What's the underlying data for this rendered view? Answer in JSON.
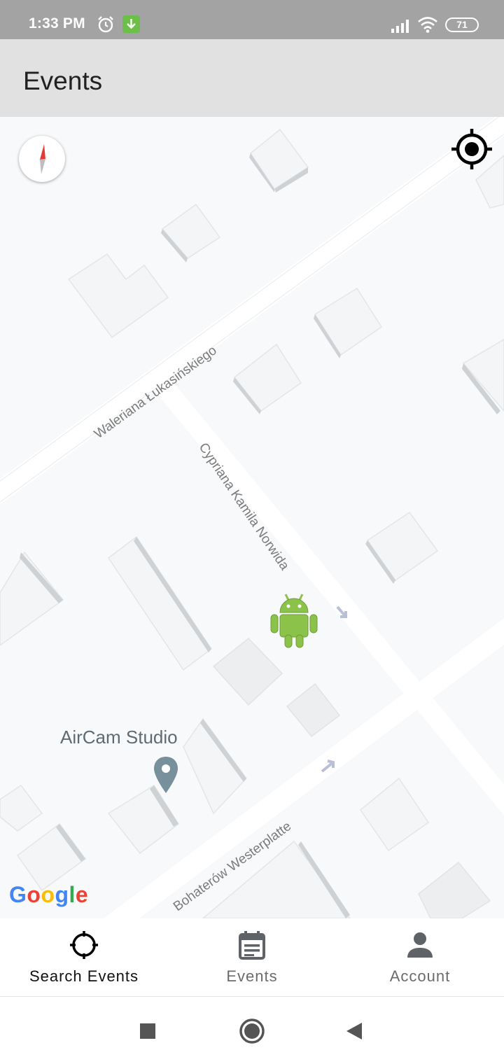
{
  "status_bar": {
    "time": "1:33 PM",
    "battery": "71",
    "icons": [
      "alarm-icon",
      "download-icon",
      "signal-icon",
      "wifi-icon",
      "battery-icon"
    ]
  },
  "app_bar": {
    "title": "Events"
  },
  "map": {
    "streets": {
      "lukasinskiego": "Waleriana Łukasińskiego",
      "norwida": "Cypriana Kamila Norwida",
      "westerplatte": "Bohaterów Westerplatte"
    },
    "poi": {
      "name": "AirCam Studio",
      "icon": "map-pin-icon"
    },
    "marker_icon": "android-icon",
    "attribution": "Google",
    "colors": {
      "background": "#f8f9fa",
      "road": "#ffffff",
      "building": "#f1f3f4",
      "accent_android": "#8bc34a"
    }
  },
  "bottom_nav": {
    "items": [
      {
        "label": "Search Events",
        "icon": "crosshair-icon",
        "active": true
      },
      {
        "label": "Events",
        "icon": "event-note-icon",
        "active": false
      },
      {
        "label": "Account",
        "icon": "person-icon",
        "active": false
      }
    ]
  },
  "system_nav": {
    "icons": [
      "recents-square-icon",
      "home-circle-icon",
      "back-triangle-icon"
    ]
  }
}
